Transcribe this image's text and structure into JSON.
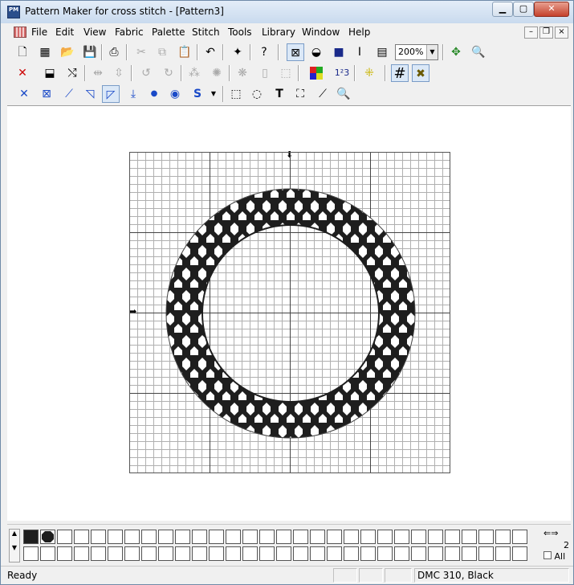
{
  "window": {
    "title": "Pattern Maker for cross stitch - [Pattern3]",
    "app_icon_text": "PM",
    "caption": {
      "minimize": "▁",
      "maximize": "▢",
      "close": "✕"
    }
  },
  "menu": {
    "items": [
      "File",
      "Edit",
      "View",
      "Fabric",
      "Palette",
      "Stitch",
      "Tools",
      "Library",
      "Window",
      "Help"
    ],
    "mdi": {
      "minimize": "–",
      "restore": "❐",
      "close": "×"
    }
  },
  "toolbar1": {
    "zoom_value": "200%",
    "buttons": [
      "new-icon",
      "new-from-image-icon",
      "open-icon",
      "save-icon",
      "print-icon",
      "cut-icon",
      "copy-icon",
      "paste-icon",
      "undo-icon",
      "wizard-icon",
      "help-icon",
      "view-stitches-icon",
      "view-symbols-icon",
      "view-blocks-icon",
      "text-cursor-icon",
      "report-icon",
      "zoom-fit-icon",
      "zoom-icon"
    ]
  },
  "toolbar2": {
    "buttons": [
      "delete-icon",
      "replace-color-icon",
      "swap-color-icon",
      "flip-horizontal-icon",
      "flip-vertical-icon",
      "rotate-left-icon",
      "rotate-right-icon",
      "mirror-icon",
      "blob-icon",
      "effect-icon",
      "outline-icon",
      "clipboard-icon",
      "palette-icon",
      "numbers-icon",
      "highlight-icon",
      "grid-icon",
      "cross-icon"
    ],
    "numbers_label": "1²3"
  },
  "toolbar3": {
    "buttons": [
      "full-stitch-icon",
      "half-stitch-icon",
      "quarter-stitch-icon",
      "three-quarter-stitch-icon",
      "backstitch-icon",
      "long-stitch-icon",
      "french-knot-icon",
      "bead-icon",
      "specialty-stitch-icon",
      "dropdown-arrow-icon",
      "rect-select-icon",
      "lasso-select-icon",
      "text-tool-icon",
      "fill-icon",
      "eyedropper-icon",
      "magnifier-icon"
    ],
    "s_label": "S",
    "t_label": "T"
  },
  "palette": {
    "counter": "2",
    "all_label": "All"
  },
  "status": {
    "text": "Ready",
    "color_info": "DMC  310, Black"
  }
}
